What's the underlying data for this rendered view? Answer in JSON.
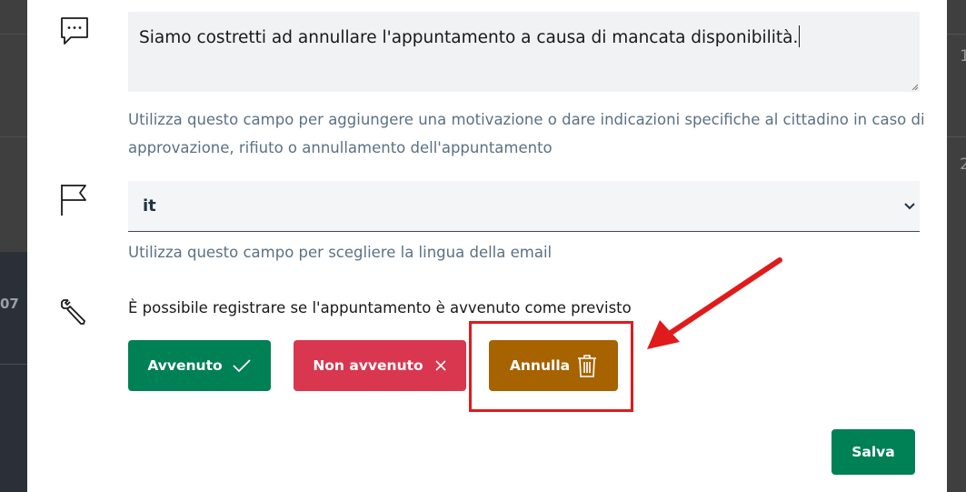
{
  "backdrop": {
    "left_date_fragment": "07",
    "right_numbers": [
      "1",
      "2"
    ]
  },
  "modal": {
    "message_field": {
      "icon": "chat-bubble-icon",
      "value": "Siamo costretti ad annullare l'appuntamento a causa di mancata disponibilità.",
      "hint": "Utilizza questo campo per aggiungere una motivazione o dare indicazioni specifiche al cittadino in caso di approvazione, rifiuto o annullamento dell'appuntamento"
    },
    "language_field": {
      "icon": "flag-icon",
      "selected": "it",
      "hint": "Utilizza questo campo per scegliere la lingua della email"
    },
    "status_section": {
      "icon": "wrench-icon",
      "text": "È possibile registrare se l'appuntamento è avvenuto come previsto",
      "buttons": {
        "done": "Avvenuto",
        "not_done": "Non avvenuto",
        "cancel": "Annulla"
      }
    },
    "save_label": "Salva"
  },
  "colors": {
    "green": "#008055",
    "red": "#d9364f",
    "amber": "#a66300",
    "annotation_red": "#e01b1b"
  }
}
